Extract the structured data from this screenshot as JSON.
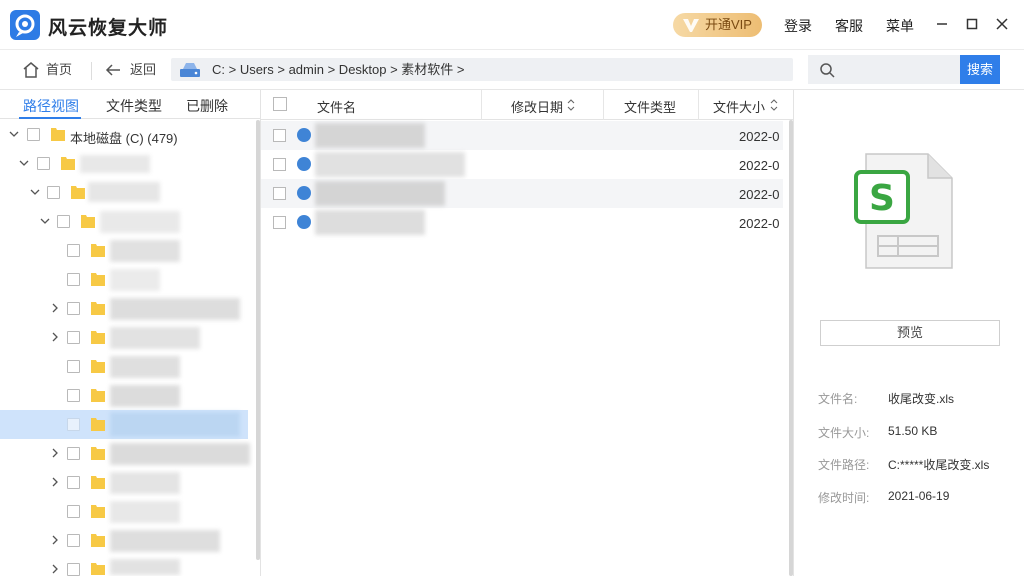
{
  "app": {
    "title": "风云恢复大师",
    "vip_label": "开通VIP",
    "login_label": "登录",
    "service_label": "客服",
    "menu_label": "菜单"
  },
  "toolbar": {
    "home_label": "首页",
    "back_label": "返回",
    "path": "C:  >  Users  >  admin  >  Desktop  >  素材软件  >",
    "search_placeholder": "",
    "search_button": "搜索"
  },
  "tree": {
    "tabs": [
      {
        "label": "路径视图",
        "active": true
      },
      {
        "label": "文件类型",
        "active": false
      },
      {
        "label": "已删除",
        "active": false
      }
    ],
    "root_label": "本地磁盘 (C) (479)"
  },
  "file_list": {
    "columns": [
      "文件名",
      "修改日期",
      "文件类型",
      "文件大小"
    ],
    "rows": [
      {
        "date": "2022-0"
      },
      {
        "date": "2022-0"
      },
      {
        "date": "2022-0"
      },
      {
        "date": "2022-0"
      }
    ]
  },
  "preview": {
    "button_label": "预览",
    "labels": {
      "name": "文件名:",
      "size": "文件大小:",
      "path": "文件路径:",
      "mtime": "修改时间:"
    },
    "values": {
      "name": "收尾改变.xls",
      "size": "51.50 KB",
      "path": "C:*****收尾改变.xls",
      "mtime": "2021-06-19"
    }
  },
  "colors": {
    "accent": "#2f7ee9",
    "selected_row": "#cfe3fb",
    "vip_gold": "#edbd73",
    "spreadsheet_green": "#3aa642"
  }
}
